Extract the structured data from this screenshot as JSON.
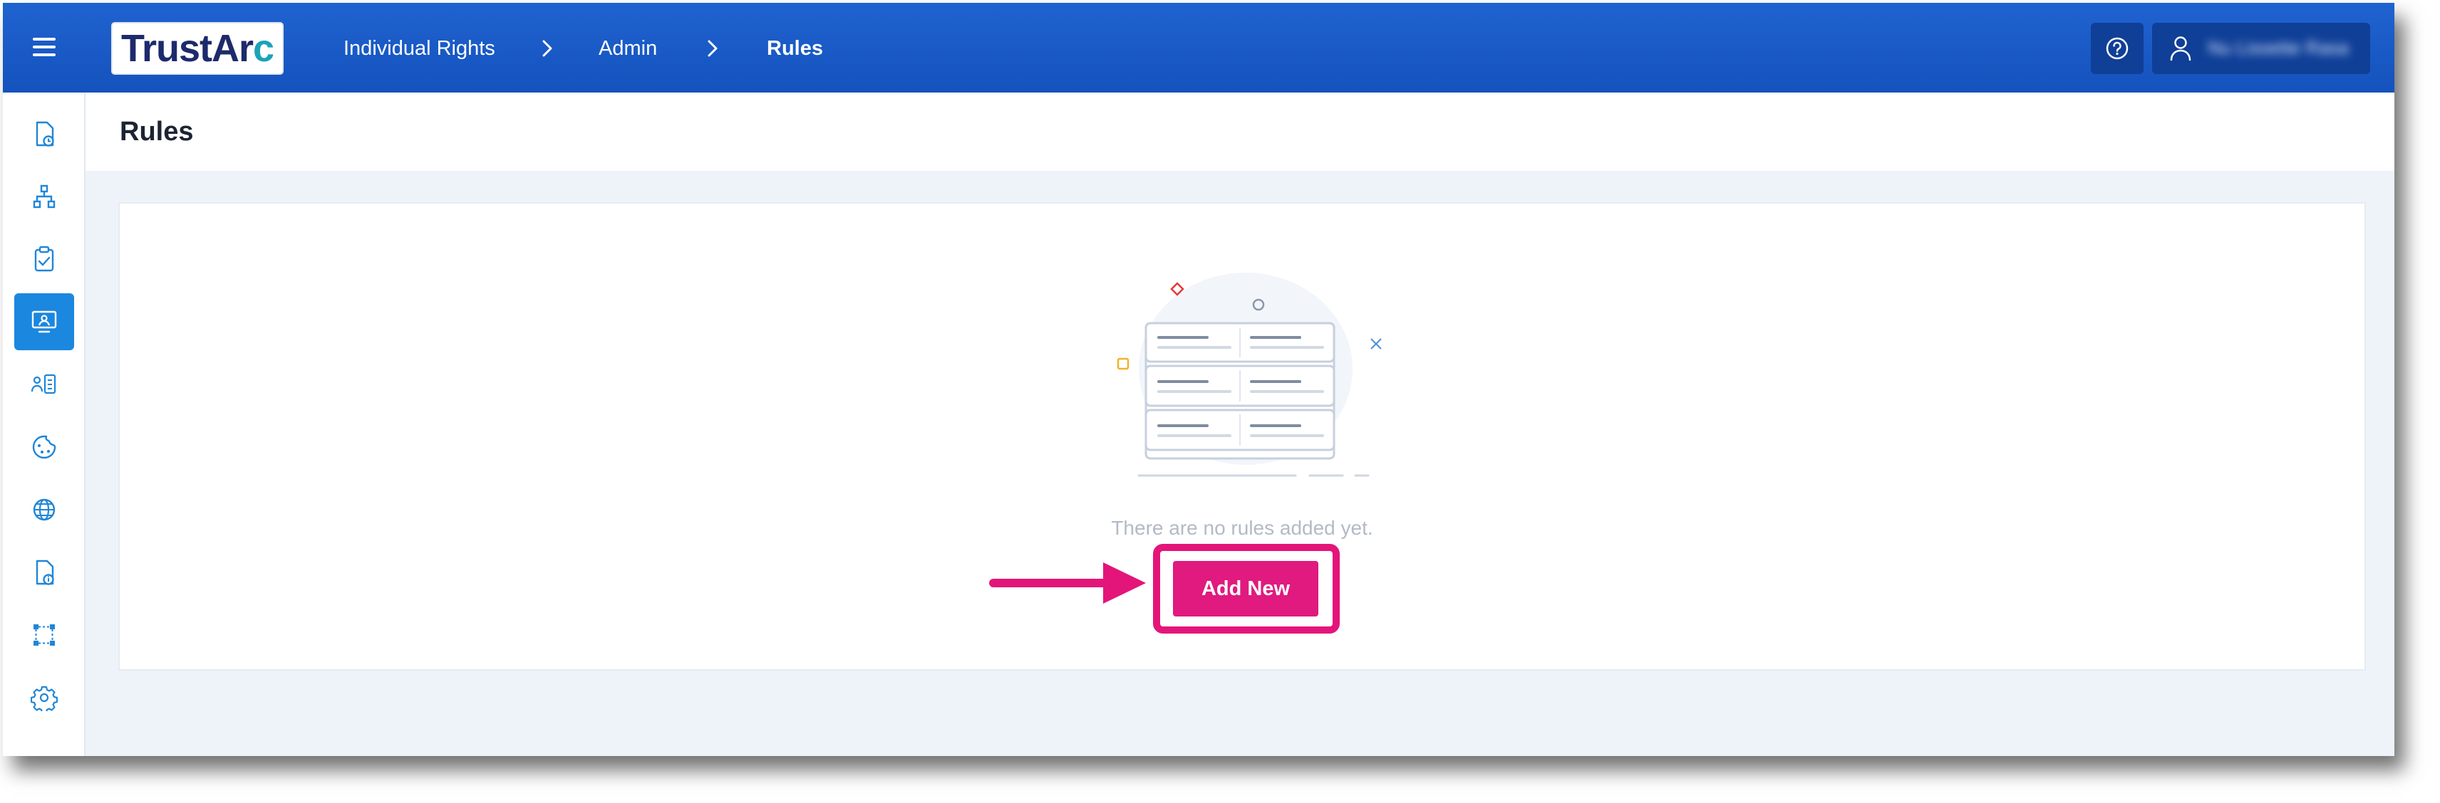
{
  "app": {
    "logo_text_main": "TrustAr",
    "logo_text_accent": "c",
    "brand_color": "#1552bd",
    "accent_color": "#e01a7e"
  },
  "header": {
    "menu_icon": "hamburger-icon",
    "breadcrumb": [
      "Individual Rights",
      "Admin",
      "Rules"
    ],
    "help_icon": "help-circle-icon",
    "user_icon": "user-icon",
    "user_name": "Nu Lissette Rasa"
  },
  "sidebar": {
    "items": [
      {
        "icon": "document-clock-icon",
        "active": false
      },
      {
        "icon": "sitemap-icon",
        "active": false
      },
      {
        "icon": "clipboard-check-icon",
        "active": false
      },
      {
        "icon": "monitor-user-icon",
        "active": true
      },
      {
        "icon": "people-list-icon",
        "active": false
      },
      {
        "icon": "palette-icon",
        "active": false
      },
      {
        "icon": "globe-icon",
        "active": false
      },
      {
        "icon": "document-info-icon",
        "active": false
      },
      {
        "icon": "workflow-icon",
        "active": false
      },
      {
        "icon": "gear-icon",
        "active": false
      }
    ]
  },
  "page": {
    "title": "Rules",
    "empty_message": "There are no rules added yet.",
    "add_button_label": "Add New"
  }
}
